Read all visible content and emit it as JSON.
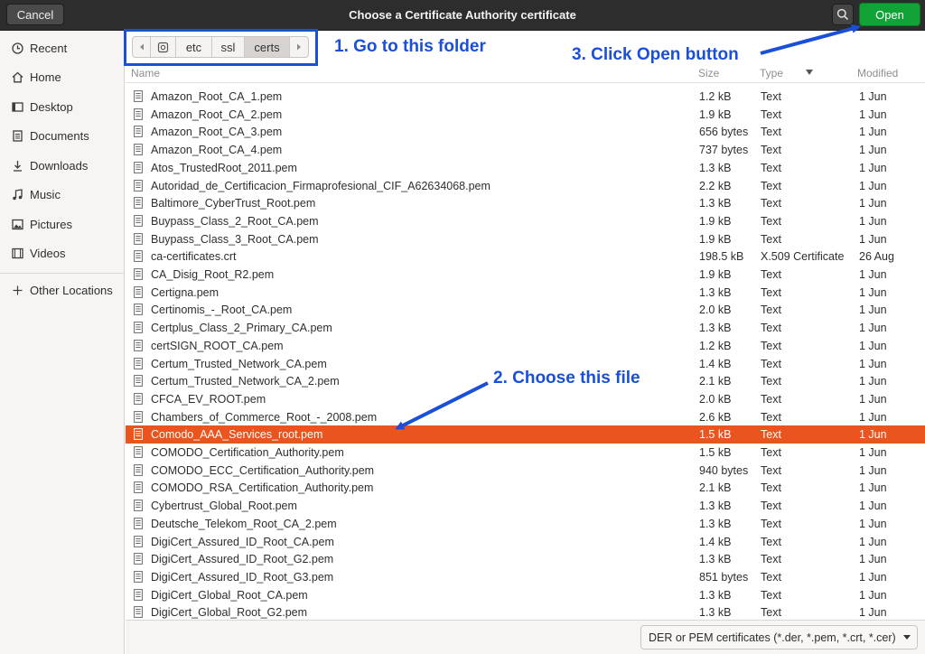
{
  "header": {
    "cancel_label": "Cancel",
    "title": "Choose a Certificate Authority certificate",
    "open_label": "Open",
    "open_color": "#11a336"
  },
  "sidebar": {
    "items": [
      {
        "label": "Recent",
        "icon": "clock-icon"
      },
      {
        "label": "Home",
        "icon": "home-icon"
      },
      {
        "label": "Desktop",
        "icon": "desktop-icon"
      },
      {
        "label": "Documents",
        "icon": "documents-icon"
      },
      {
        "label": "Downloads",
        "icon": "download-icon"
      },
      {
        "label": "Music",
        "icon": "music-icon"
      },
      {
        "label": "Pictures",
        "icon": "pictures-icon"
      },
      {
        "label": "Videos",
        "icon": "videos-icon"
      },
      {
        "label": "Other Locations",
        "icon": "plus-icon"
      }
    ]
  },
  "path": {
    "segments": [
      "etc",
      "ssl",
      "certs"
    ],
    "active": "certs"
  },
  "annotations": {
    "step1": "1. Go to this folder",
    "step2": "2. Choose this file",
    "step3": "3. Click Open button",
    "color": "#1a4fd8"
  },
  "columns": {
    "name": "Name",
    "size": "Size",
    "type": "Type",
    "modified": "Modified"
  },
  "files": [
    {
      "name": "Amazon_Root_CA_1.pem",
      "size": "1.2 kB",
      "type": "Text",
      "modified": "1 Jun"
    },
    {
      "name": "Amazon_Root_CA_2.pem",
      "size": "1.9 kB",
      "type": "Text",
      "modified": "1 Jun"
    },
    {
      "name": "Amazon_Root_CA_3.pem",
      "size": "656 bytes",
      "type": "Text",
      "modified": "1 Jun"
    },
    {
      "name": "Amazon_Root_CA_4.pem",
      "size": "737 bytes",
      "type": "Text",
      "modified": "1 Jun"
    },
    {
      "name": "Atos_TrustedRoot_2011.pem",
      "size": "1.3 kB",
      "type": "Text",
      "modified": "1 Jun"
    },
    {
      "name": "Autoridad_de_Certificacion_Firmaprofesional_CIF_A62634068.pem",
      "size": "2.2 kB",
      "type": "Text",
      "modified": "1 Jun"
    },
    {
      "name": "Baltimore_CyberTrust_Root.pem",
      "size": "1.3 kB",
      "type": "Text",
      "modified": "1 Jun"
    },
    {
      "name": "Buypass_Class_2_Root_CA.pem",
      "size": "1.9 kB",
      "type": "Text",
      "modified": "1 Jun"
    },
    {
      "name": "Buypass_Class_3_Root_CA.pem",
      "size": "1.9 kB",
      "type": "Text",
      "modified": "1 Jun"
    },
    {
      "name": "ca-certificates.crt",
      "size": "198.5 kB",
      "type": "X.509 Certificate",
      "modified": "26 Aug"
    },
    {
      "name": "CA_Disig_Root_R2.pem",
      "size": "1.9 kB",
      "type": "Text",
      "modified": "1 Jun"
    },
    {
      "name": "Certigna.pem",
      "size": "1.3 kB",
      "type": "Text",
      "modified": "1 Jun"
    },
    {
      "name": "Certinomis_-_Root_CA.pem",
      "size": "2.0 kB",
      "type": "Text",
      "modified": "1 Jun"
    },
    {
      "name": "Certplus_Class_2_Primary_CA.pem",
      "size": "1.3 kB",
      "type": "Text",
      "modified": "1 Jun"
    },
    {
      "name": "certSIGN_ROOT_CA.pem",
      "size": "1.2 kB",
      "type": "Text",
      "modified": "1 Jun"
    },
    {
      "name": "Certum_Trusted_Network_CA.pem",
      "size": "1.4 kB",
      "type": "Text",
      "modified": "1 Jun"
    },
    {
      "name": "Certum_Trusted_Network_CA_2.pem",
      "size": "2.1 kB",
      "type": "Text",
      "modified": "1 Jun"
    },
    {
      "name": "CFCA_EV_ROOT.pem",
      "size": "2.0 kB",
      "type": "Text",
      "modified": "1 Jun"
    },
    {
      "name": "Chambers_of_Commerce_Root_-_2008.pem",
      "size": "2.6 kB",
      "type": "Text",
      "modified": "1 Jun"
    },
    {
      "name": "Comodo_AAA_Services_root.pem",
      "size": "1.5 kB",
      "type": "Text",
      "modified": "1 Jun",
      "selected": true
    },
    {
      "name": "COMODO_Certification_Authority.pem",
      "size": "1.5 kB",
      "type": "Text",
      "modified": "1 Jun"
    },
    {
      "name": "COMODO_ECC_Certification_Authority.pem",
      "size": "940 bytes",
      "type": "Text",
      "modified": "1 Jun"
    },
    {
      "name": "COMODO_RSA_Certification_Authority.pem",
      "size": "2.1 kB",
      "type": "Text",
      "modified": "1 Jun"
    },
    {
      "name": "Cybertrust_Global_Root.pem",
      "size": "1.3 kB",
      "type": "Text",
      "modified": "1 Jun"
    },
    {
      "name": "Deutsche_Telekom_Root_CA_2.pem",
      "size": "1.3 kB",
      "type": "Text",
      "modified": "1 Jun"
    },
    {
      "name": "DigiCert_Assured_ID_Root_CA.pem",
      "size": "1.4 kB",
      "type": "Text",
      "modified": "1 Jun"
    },
    {
      "name": "DigiCert_Assured_ID_Root_G2.pem",
      "size": "1.3 kB",
      "type": "Text",
      "modified": "1 Jun"
    },
    {
      "name": "DigiCert_Assured_ID_Root_G3.pem",
      "size": "851 bytes",
      "type": "Text",
      "modified": "1 Jun"
    },
    {
      "name": "DigiCert_Global_Root_CA.pem",
      "size": "1.3 kB",
      "type": "Text",
      "modified": "1 Jun"
    },
    {
      "name": "DigiCert_Global_Root_G2.pem",
      "size": "1.3 kB",
      "type": "Text",
      "modified": "1 Jun"
    }
  ],
  "selection_color": "#e9541f",
  "filter": {
    "selected": "DER or PEM certificates (*.der, *.pem, *.crt, *.cer)"
  }
}
